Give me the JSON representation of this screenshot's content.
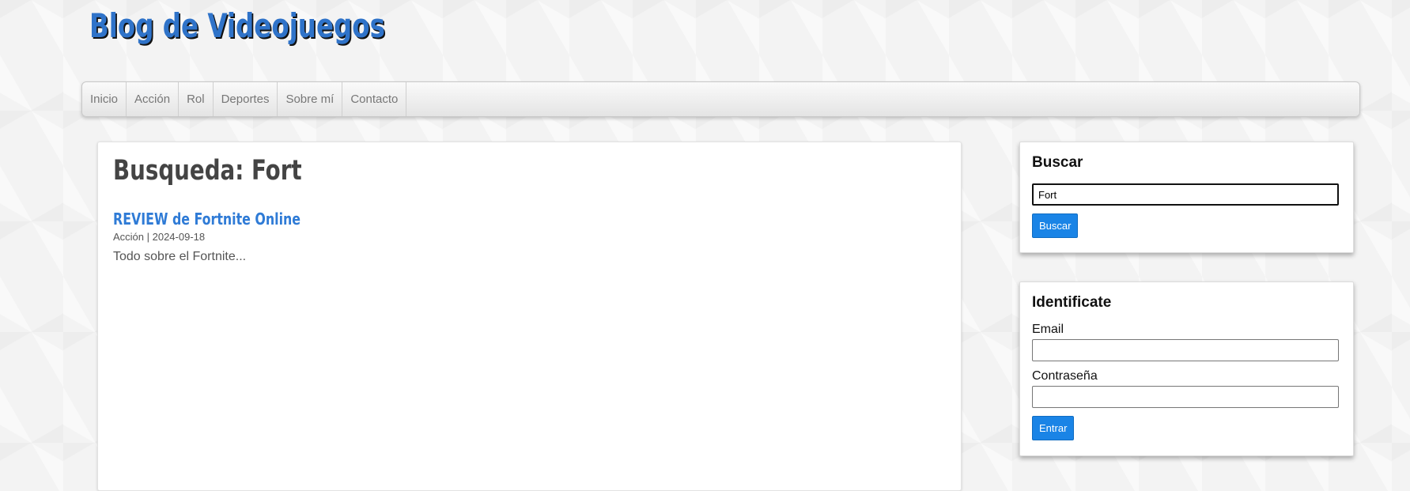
{
  "site": {
    "title": "Blog de Videojuegos"
  },
  "nav": {
    "items": [
      "Inicio",
      "Acción",
      "Rol",
      "Deportes",
      "Sobre mí",
      "Contacto"
    ]
  },
  "main": {
    "heading": "Busqueda: Fort",
    "results": [
      {
        "title": "REVIEW de Fortnite Online",
        "meta": "Acción | 2024-09-18",
        "excerpt": "Todo sobre el Fortnite..."
      }
    ]
  },
  "search_widget": {
    "title": "Buscar",
    "value": "Fort",
    "button": "Buscar"
  },
  "login_widget": {
    "title": "Identificate",
    "email_label": "Email",
    "email_value": "",
    "password_label": "Contraseña",
    "password_value": "",
    "button": "Entrar"
  },
  "colors": {
    "accent": "#2f7bd6",
    "button": "#1a84e6"
  }
}
